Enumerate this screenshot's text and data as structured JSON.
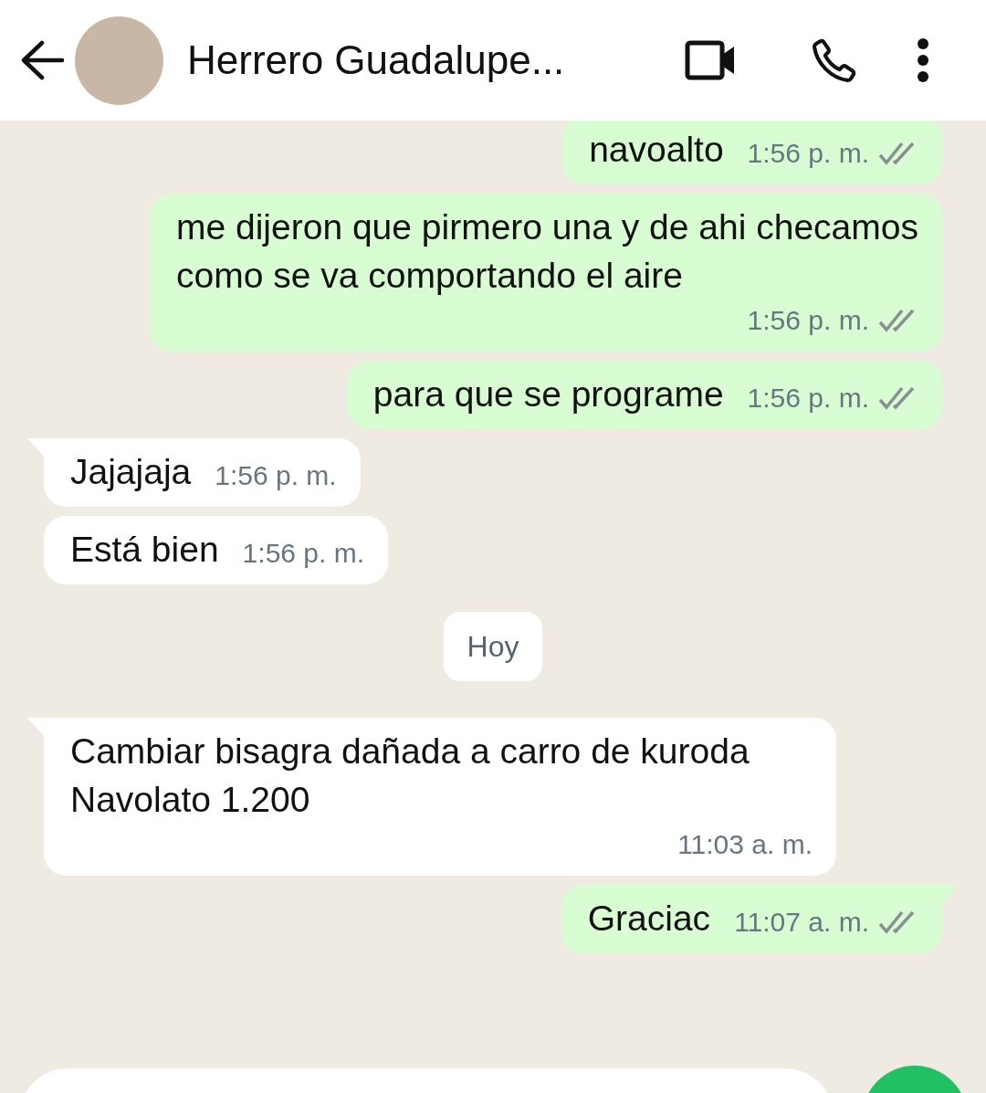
{
  "header": {
    "contact_name": "Herrero Guadalupe..."
  },
  "messages": [
    {
      "kind": "sent",
      "text": "navoalto",
      "time": "1:56 p. m.",
      "tail": false
    },
    {
      "kind": "sent",
      "text": "me dijeron que pirmero una y de ahi checamos como se va comportando el aire",
      "time": "1:56 p. m.",
      "tail": false
    },
    {
      "kind": "sent",
      "text": "para que se programe",
      "time": "1:56 p. m.",
      "tail": false
    },
    {
      "kind": "received",
      "text": "Jajajaja",
      "time": "1:56 p. m.",
      "tail": true
    },
    {
      "kind": "received",
      "text": "Está bien",
      "time": "1:56 p. m.",
      "tail": false
    },
    {
      "kind": "date",
      "text": "Hoy"
    },
    {
      "kind": "received",
      "text": "Cambiar bisagra dañada a carro de kuroda Navolato 1.200",
      "time": "11:03 a. m.",
      "tail": true
    },
    {
      "kind": "sent",
      "text": "Graciac",
      "time": "11:07 a. m.",
      "tail": true
    }
  ]
}
